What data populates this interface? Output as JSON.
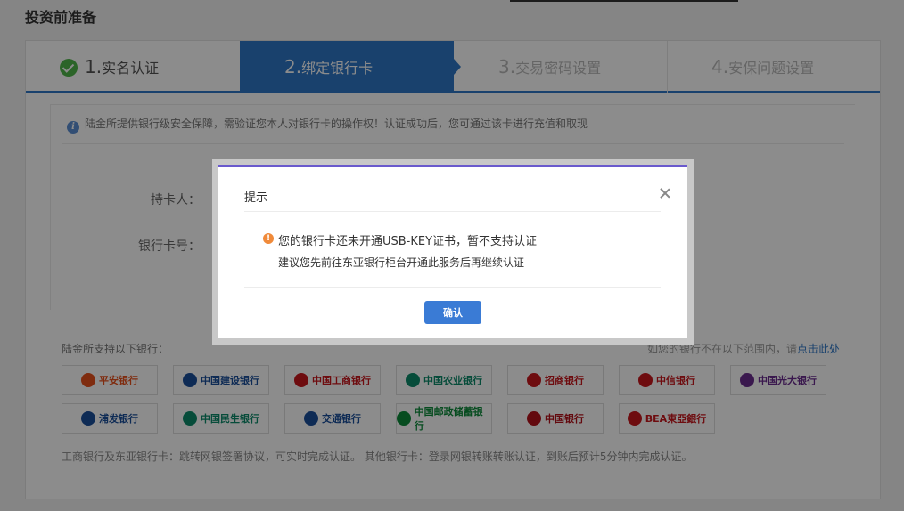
{
  "page": {
    "title": "投资前准备"
  },
  "steps": [
    {
      "num": "1.",
      "label": "实名认证",
      "status": "done"
    },
    {
      "num": "2.",
      "label": "绑定银行卡",
      "status": "active"
    },
    {
      "num": "3.",
      "label": "交易密码设置",
      "status": "pending"
    },
    {
      "num": "4.",
      "label": "安保问题设置",
      "status": "pending"
    }
  ],
  "notice": {
    "text": "陆金所提供银行级安全保障，需验证您本人对银行卡的操作权！认证成功后，您可通过该卡进行充值和取现"
  },
  "form": {
    "cardholder_label": "持卡人：",
    "card_number_label": "银行卡号："
  },
  "banks": {
    "title": "陆金所支持以下银行：",
    "help_text": "如您的银行不在以下范围内，请",
    "help_link": "点击此处",
    "list": [
      {
        "name": "平安银行",
        "color": "#e8501c"
      },
      {
        "name": "中国建设银行",
        "color": "#1b4f9c"
      },
      {
        "name": "中国工商银行",
        "color": "#c8161d"
      },
      {
        "name": "中国农业银行",
        "color": "#0c8a6a"
      },
      {
        "name": "招商银行",
        "color": "#c8161d"
      },
      {
        "name": "中信银行",
        "color": "#c8161d"
      },
      {
        "name": "中国光大银行",
        "color": "#6b2c8e"
      },
      {
        "name": "浦发银行",
        "color": "#1b4f9c"
      },
      {
        "name": "中国民生银行",
        "color": "#0c8a6a"
      },
      {
        "name": "交通银行",
        "color": "#1b4f9c"
      },
      {
        "name": "中国邮政储蓄银行",
        "color": "#0c8a3a"
      },
      {
        "name": "中国银行",
        "color": "#b4121a"
      },
      {
        "name": "BEA東亞銀行",
        "color": "#c8161d"
      }
    ]
  },
  "footnote": {
    "text": "工商银行及东亚银行卡：跳转网银签署协议，可实时完成认证。    其他银行卡：登录网银转账转账认证，到账后预计5分钟内完成认证。"
  },
  "dialog": {
    "title": "提示",
    "message": "您的银行卡还未开通USB-KEY证书，暂不支持认证",
    "submessage": "建议您先前往东亚银行柜台开通此服务后再继续认证",
    "confirm_label": "确认"
  }
}
